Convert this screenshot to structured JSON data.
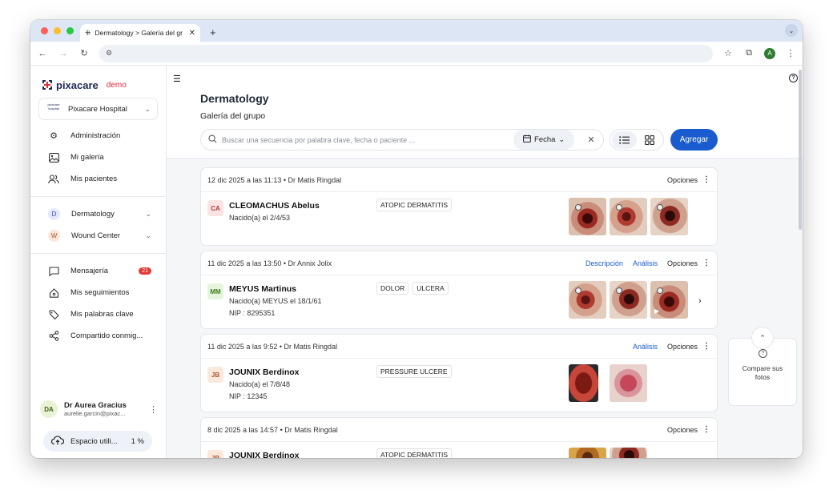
{
  "browser": {
    "tab_title": "Dermatology > Galería del gr",
    "profile_initial": "A"
  },
  "colors": {
    "primary": "#1a5ccf",
    "brand_navy": "#1e2a5a",
    "brand_red": "#e5283a",
    "badge_red": "#e53935"
  },
  "sidebar": {
    "brand": "pixacare",
    "brand_suffix": "demo",
    "hospital": "Pixacare Hospital",
    "hospital_logo_text": "pixacare hospital",
    "items": [
      {
        "label": "Administración",
        "icon": "gear-icon"
      },
      {
        "label": "Mi galería",
        "icon": "image-icon"
      },
      {
        "label": "Mis pacientes",
        "icon": "users-icon"
      }
    ],
    "groups": [
      {
        "initial": "D",
        "label": "Dermatology"
      },
      {
        "initial": "W",
        "label": "Wound Center"
      }
    ],
    "items2": [
      {
        "label": "Mensajería",
        "icon": "message-icon",
        "badge": "21"
      },
      {
        "label": "Mis seguimientos",
        "icon": "home-icon"
      },
      {
        "label": "Mis palabras clave",
        "icon": "tag-icon"
      },
      {
        "label": "Compartido conmig...",
        "icon": "share-icon"
      }
    ],
    "user": {
      "initials": "DA",
      "name": "Dr Aurea Gracius",
      "email": "aurelie.garcin@pixac..."
    },
    "storage": {
      "label": "Espacio utili...",
      "value": "1 %"
    }
  },
  "main": {
    "title": "Dermatology",
    "subtitle": "Galería del grupo",
    "search_placeholder": "Buscar una secuencia por palabra clave, fecha o paciente ...",
    "date_filter": "Fecha",
    "add_button": "Agregar",
    "compare_label": "Compare sus fotos"
  },
  "cards": [
    {
      "meta": "12 dic 2025 a las 11:13  •  Dr Matis Ringdal",
      "links": [],
      "options": "Opciones",
      "initials": "CA",
      "patient": "CLEOMACHUS Abelus",
      "born": "Nacido(a) el 2/4/53",
      "nip": "",
      "tags": [
        "ATOPIC DERMATITIS"
      ]
    },
    {
      "meta": "11 dic 2025 a las 13:50  •  Dr Annix Jolix",
      "links": [
        "Descripción",
        "Análisis"
      ],
      "options": "Opciones",
      "initials": "MM",
      "patient": "MEYUS Martinus",
      "born": "Nacido(a) MEYUS el 18/1/61",
      "nip": "NIP : 8295351",
      "tags": [
        "DOLOR",
        "ULCERA"
      ]
    },
    {
      "meta": "11 dic 2025 a las 9:52  •  Dr Matis Ringdal",
      "links": [
        "Análisis"
      ],
      "options": "Opciones",
      "initials": "JB",
      "patient": "JOUNIX Berdinox",
      "born": "Nacido(a) el 7/8/48",
      "nip": "NIP : 12345",
      "tags": [
        "PRESSURE ULCERE"
      ]
    },
    {
      "meta": "8 dic 2025 a las 14:57  •  Dr Matis Ringdal",
      "links": [],
      "options": "Opciones",
      "initials": "JB",
      "patient": "JOUNIX Berdinox",
      "born": "",
      "nip": "",
      "tags": [
        "ATOPIC DERMATITIS"
      ]
    }
  ]
}
